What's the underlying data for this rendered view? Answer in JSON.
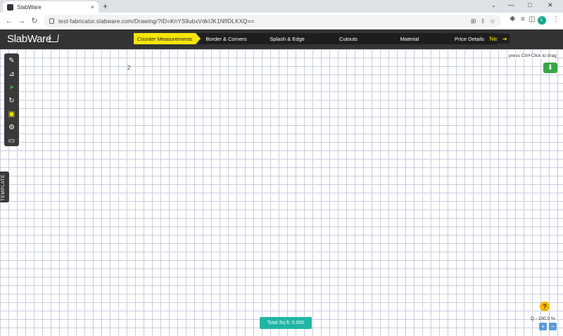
{
  "browser": {
    "tab_title": "SlabWare",
    "tab_close": "×",
    "new_tab": "+",
    "url": "test-fabricator.slabware.com/Drawing/?ID=KnYS9ubxVdkIJK1NfIDLKXQ==",
    "back": "←",
    "forward": "→",
    "reload": "↻",
    "profile_initial": "L",
    "minimize": "—",
    "maximize": "□",
    "close": "✕",
    "tabs_menu": "⌄"
  },
  "app": {
    "logo": "SlabWare",
    "steps": [
      {
        "label": "Counter Measurements",
        "active": true
      },
      {
        "label": "Border & Corners",
        "active": false
      },
      {
        "label": "Splash & Edge",
        "active": false
      },
      {
        "label": "Cutouts",
        "active": false
      },
      {
        "label": "Material",
        "active": false
      },
      {
        "label": "Price Details",
        "active": false
      }
    ],
    "next_label": "Next",
    "next_arrow": "➔"
  },
  "canvas": {
    "hint": "press Ctrl+Click to drag",
    "cursor_text": "2",
    "side_tab": "TEMPLATE",
    "total_label": "Total Sq ft: 0.000",
    "help": "?",
    "zoom_label": "Q - 100.0 %",
    "zoom_in": "+",
    "zoom_out": "−",
    "download": "⬇"
  },
  "tools": [
    {
      "name": "pencil-icon",
      "glyph": "✎",
      "color": "white"
    },
    {
      "name": "measure-icon",
      "glyph": "📐",
      "color": "white"
    },
    {
      "name": "shape-icon",
      "glyph": "➤",
      "color": "green"
    },
    {
      "name": "redo-icon",
      "glyph": "↻",
      "color": "white"
    },
    {
      "name": "save-icon",
      "glyph": "💾",
      "color": "yellow"
    },
    {
      "name": "gear-icon",
      "glyph": "⚙",
      "color": "white"
    },
    {
      "name": "laptop-icon",
      "glyph": "▭",
      "color": "white"
    }
  ]
}
